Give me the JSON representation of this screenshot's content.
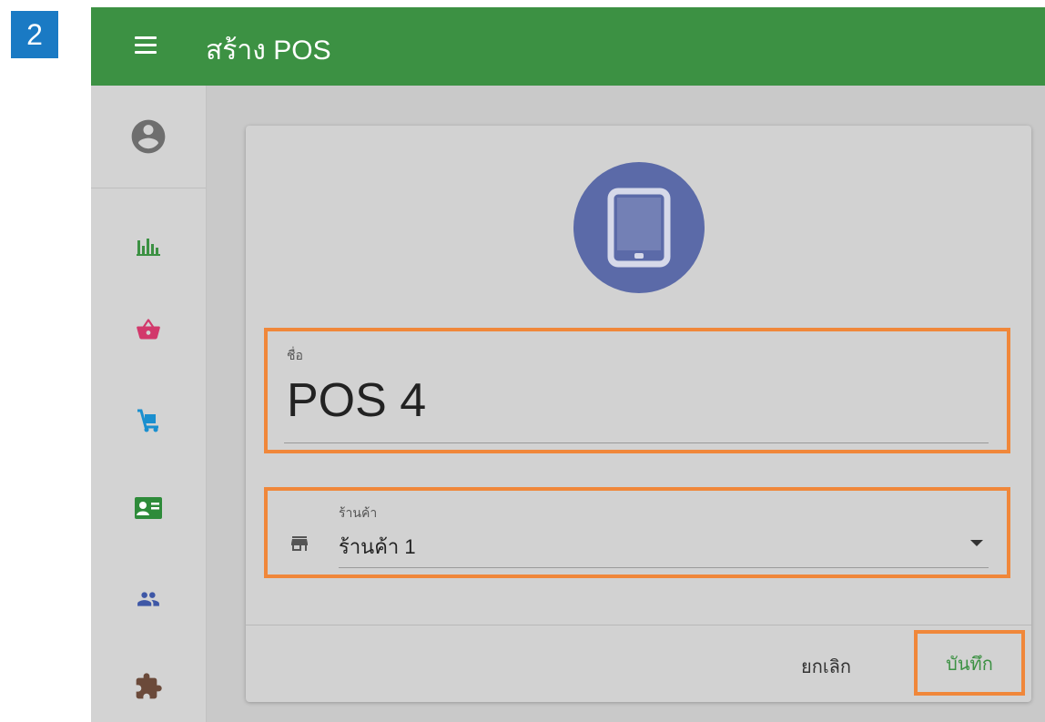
{
  "step_badge": "2",
  "appbar": {
    "title": "สร้าง POS",
    "menu_icon": "menu-icon"
  },
  "sidebar": {
    "items": [
      {
        "icon": "account-circle-icon",
        "color": "#6e6e6e"
      },
      {
        "icon": "bar-chart-icon",
        "color": "#3c9143"
      },
      {
        "icon": "shopping-basket-icon",
        "color": "#d2386b"
      },
      {
        "icon": "hand-truck-icon",
        "color": "#1a8fcf"
      },
      {
        "icon": "contact-card-icon",
        "color": "#2e8b3a"
      },
      {
        "icon": "people-icon",
        "color": "#3e57a6"
      },
      {
        "icon": "extension-icon",
        "color": "#6b4a3a"
      }
    ]
  },
  "form": {
    "avatar_icon": "tablet-icon",
    "name_label": "ชื่อ",
    "name_value": "POS 4",
    "shop_label": "ร้านค้า",
    "shop_value": "ร้านค้า 1",
    "shop_icon": "store-icon"
  },
  "actions": {
    "cancel": "ยกเลิก",
    "save": "บันทึก"
  },
  "colors": {
    "primary": "#3c9143",
    "highlight": "#f0873a",
    "badge": "#1a7ac4",
    "avatar_bg": "#5b6aa8"
  }
}
